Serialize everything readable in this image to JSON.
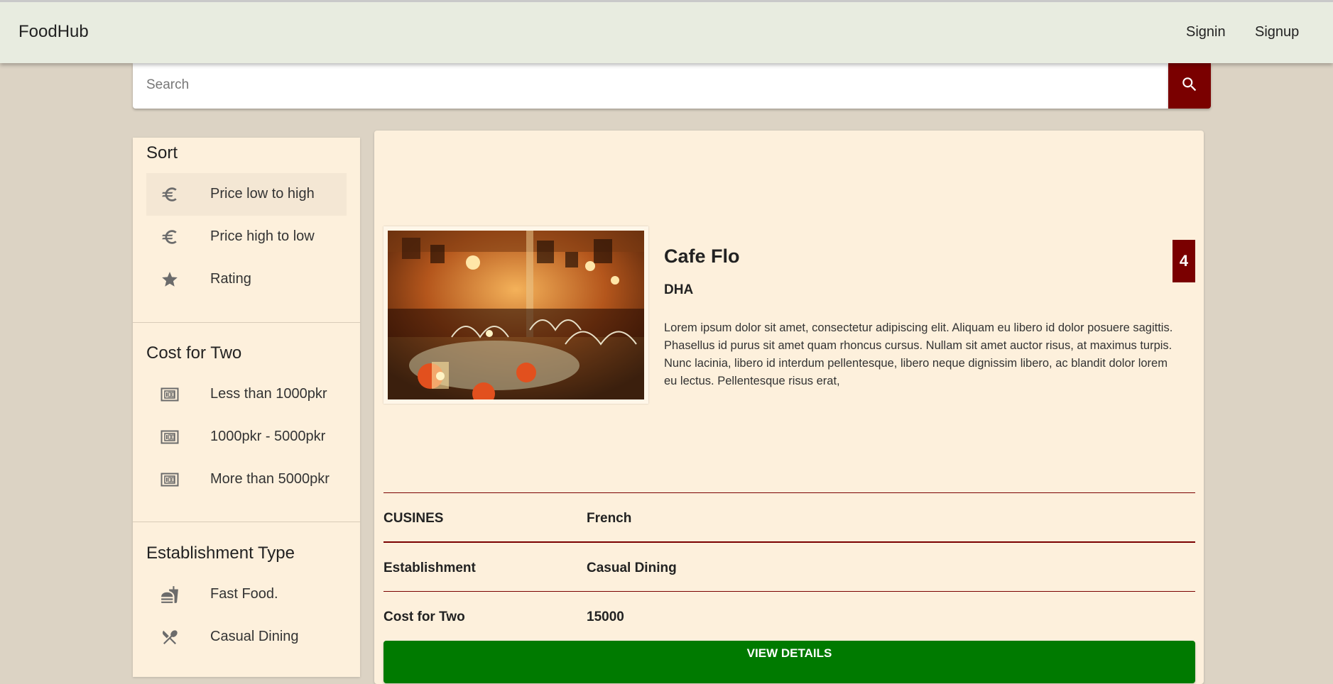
{
  "header": {
    "brand": "FoodHub",
    "signin_label": "Signin",
    "signup_label": "Signup"
  },
  "search": {
    "placeholder": "Search",
    "value": "",
    "button_icon": "search-icon"
  },
  "sidebar": {
    "sort": {
      "title": "Sort",
      "items": [
        {
          "label": "Price low to high",
          "icon": "euro-icon",
          "active": true
        },
        {
          "label": "Price high to low",
          "icon": "euro-icon"
        },
        {
          "label": "Rating",
          "icon": "star-icon"
        }
      ]
    },
    "cost": {
      "title": "Cost for Two",
      "items": [
        {
          "label": "Less than 1000pkr",
          "icon": "money-icon"
        },
        {
          "label": "1000pkr - 5000pkr",
          "icon": "money-icon"
        },
        {
          "label": "More than 5000pkr",
          "icon": "money-icon"
        }
      ]
    },
    "establishment": {
      "title": "Establishment Type",
      "items": [
        {
          "label": "Fast Food.",
          "icon": "fastfood-icon"
        },
        {
          "label": "Casual Dining",
          "icon": "restaurant-icon"
        }
      ]
    }
  },
  "restaurant": {
    "name": "Cafe Flo",
    "area": "DHA",
    "rating": "4",
    "description": "Lorem ipsum dolor sit amet, consectetur adipiscing elit. Aliquam eu libero id dolor posuere sagittis. Phasellus id purus sit amet quam rhoncus cursus. Nullam sit amet auctor risus, at maximus turpis. Nunc lacinia, libero id interdum pellentesque, libero neque dignissim libero, ac blandit dolor lorem eu lectus. Pellentesque risus erat,",
    "photo_icon": "restaurant-photo",
    "details": [
      {
        "key": "CUSINES",
        "value": "French"
      },
      {
        "key": "Establishment",
        "value": "Casual Dining"
      },
      {
        "key": "Cost for Two",
        "value": "15000"
      }
    ],
    "view_details_label": "VIEW DETAILS"
  },
  "colors": {
    "brand_dark_red": "#7a0000",
    "button_green": "#007a00",
    "card_bg": "#fdf0dc",
    "page_bg": "#dcd3c4",
    "appbar_bg": "#e8ece0"
  }
}
